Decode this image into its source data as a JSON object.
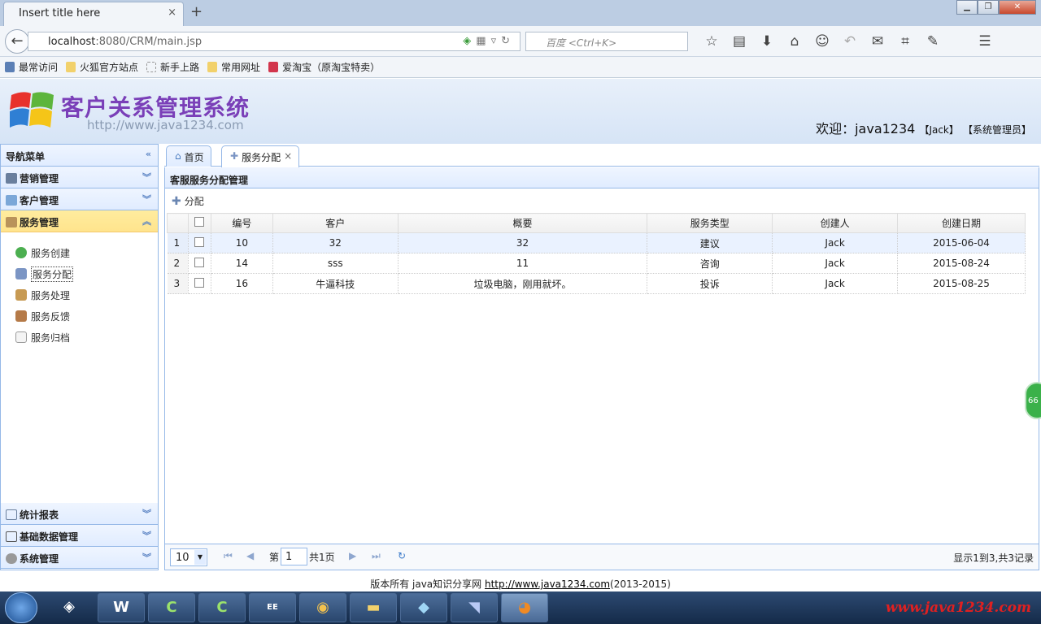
{
  "browser": {
    "tab_title": "Insert title here",
    "tab_close": "×",
    "new_tab": "+",
    "url_host": "localhost",
    "url_rest": ":8080/CRM/main.jsp",
    "search_placeholder": "百度 <Ctrl+K>",
    "bookmarks": [
      "最常访问",
      "火狐官方站点",
      "新手上路",
      "常用网址",
      "爱淘宝（原淘宝特卖）"
    ]
  },
  "header": {
    "system_title": "客户关系管理系统",
    "site_url": "http://www.java1234.com",
    "welcome_label": "欢迎：",
    "username": "java1234",
    "real_name": "【Jack】",
    "role": "【系统管理员】"
  },
  "sidebar": {
    "title": "导航菜单",
    "sections": [
      {
        "label": "营销管理"
      },
      {
        "label": "客户管理"
      },
      {
        "label": "服务管理"
      }
    ],
    "service_items": [
      {
        "label": "服务创建"
      },
      {
        "label": "服务分配"
      },
      {
        "label": "服务处理"
      },
      {
        "label": "服务反馈"
      },
      {
        "label": "服务归档"
      }
    ],
    "bottom_sections": [
      {
        "label": "统计报表"
      },
      {
        "label": "基础数据管理"
      },
      {
        "label": "系统管理"
      }
    ]
  },
  "tabs": [
    {
      "label": "首页"
    },
    {
      "label": "服务分配",
      "close": "×"
    }
  ],
  "main": {
    "panel_title": "客服服务分配管理",
    "toolbar_assign": "分配",
    "columns": [
      "编号",
      "客户",
      "概要",
      "服务类型",
      "创建人",
      "创建日期"
    ],
    "rows": [
      {
        "rn": "1",
        "id": "10",
        "customer": "32",
        "summary": "32",
        "type": "建议",
        "creator": "Jack",
        "date": "2015-06-04"
      },
      {
        "rn": "2",
        "id": "14",
        "customer": "sss",
        "summary": "11",
        "type": "咨询",
        "creator": "Jack",
        "date": "2015-08-24"
      },
      {
        "rn": "3",
        "id": "16",
        "customer": "牛逼科技",
        "summary": "垃圾电脑，刚用就坏。",
        "type": "投诉",
        "creator": "Jack",
        "date": "2015-08-25"
      }
    ],
    "pager": {
      "page_size": "10",
      "page_prefix": "第",
      "page_number": "1",
      "page_total": "共1页",
      "info": "显示1到3,共3记录"
    }
  },
  "footer": {
    "text": "版本所有 java知识分享网 ",
    "link": "http://www.java1234.com",
    "years": "(2013-2015)"
  },
  "taskbar": {
    "watermark": "www.java1234.com",
    "word_label": "W"
  },
  "colors": {
    "panel_border": "#95b8e7",
    "header_bg": "#e0ecff",
    "selected_section": "#ffe48d",
    "title_purple": "#7a3fb8",
    "watermark_red": "#e02020"
  }
}
